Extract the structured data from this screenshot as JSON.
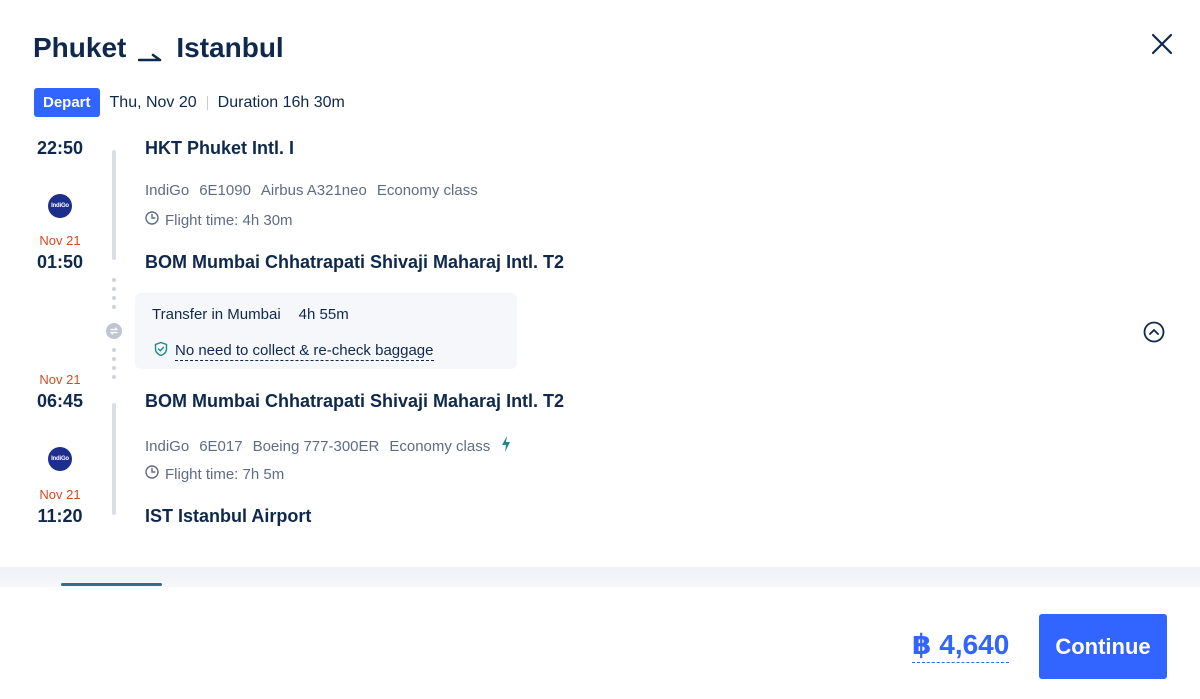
{
  "header": {
    "origin": "Phuket",
    "destination": "Istanbul",
    "close_icon": "close-icon"
  },
  "trip": {
    "badge": "Depart",
    "date": "Thu, Nov 20",
    "duration": "Duration 16h 30m"
  },
  "segments": [
    {
      "dep_time": "22:50",
      "dep_airport": "HKT Phuket Intl. I",
      "airline_logo": "IndiGo",
      "airline": "IndiGo",
      "flight_no": "6E1090",
      "aircraft": "Airbus A321neo",
      "cabin": "Economy class",
      "flight_time": "Flight time: 4h 30m",
      "arr_date": "Nov 21",
      "arr_time": "01:50",
      "arr_airport": "BOM Mumbai Chhatrapati Shivaji Maharaj Intl. T2"
    },
    {
      "dep_date": "Nov 21",
      "dep_time": "06:45",
      "dep_airport": "BOM Mumbai Chhatrapati Shivaji Maharaj Intl. T2",
      "airline_logo": "IndiGo",
      "airline": "IndiGo",
      "flight_no": "6E017",
      "aircraft": "Boeing 777-300ER",
      "cabin": "Economy class",
      "flight_time": "Flight time: 7h 5m",
      "arr_date": "Nov 21",
      "arr_time": "11:20",
      "arr_airport": "IST Istanbul Airport"
    }
  ],
  "transfer": {
    "city": "Transfer in Mumbai",
    "duration": "4h 55m",
    "baggage_note": "No need to collect & re-check baggage"
  },
  "footer": {
    "price": "฿ 4,640",
    "continue_label": "Continue"
  },
  "colors": {
    "accent": "#3264ff",
    "date_change": "#d34b20",
    "text": "#0f294d",
    "muted": "#5e6c84"
  }
}
